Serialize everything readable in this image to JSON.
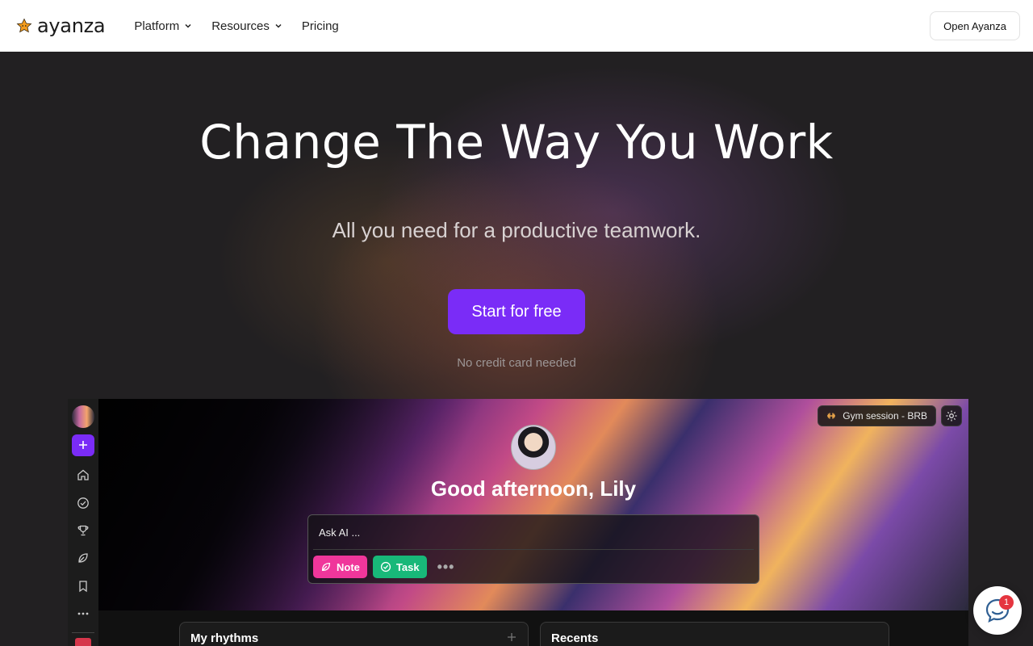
{
  "nav": {
    "logo_text": "ayanza",
    "links": [
      {
        "label": "Platform",
        "has_menu": true
      },
      {
        "label": "Resources",
        "has_menu": true
      },
      {
        "label": "Pricing",
        "has_menu": false
      }
    ],
    "cta_label": "Open Ayanza"
  },
  "hero": {
    "title": "Change The Way You Work",
    "subtitle": "All you need for a productive teamwork.",
    "button_label": "Start for free",
    "note": "No credit card needed"
  },
  "app": {
    "status_text": "Gym session - BRB",
    "greeting": "Good afternoon, Lily",
    "ask_placeholder": "Ask AI ...",
    "note_label": "Note",
    "task_label": "Task",
    "more_label": "•••",
    "panels": {
      "rhythms_title": "My rhythms",
      "recents_title": "Recents"
    },
    "rail_icons": [
      "home-icon",
      "check-circle-icon",
      "trophy-icon",
      "leaf-icon",
      "bookmark-icon",
      "more-icon"
    ]
  },
  "chat": {
    "badge": "1"
  },
  "colors": {
    "brand": "#7a2cf7",
    "note": "#f0369b",
    "task": "#18b879",
    "badge": "#e5353f",
    "logo": "#f59d1e"
  }
}
